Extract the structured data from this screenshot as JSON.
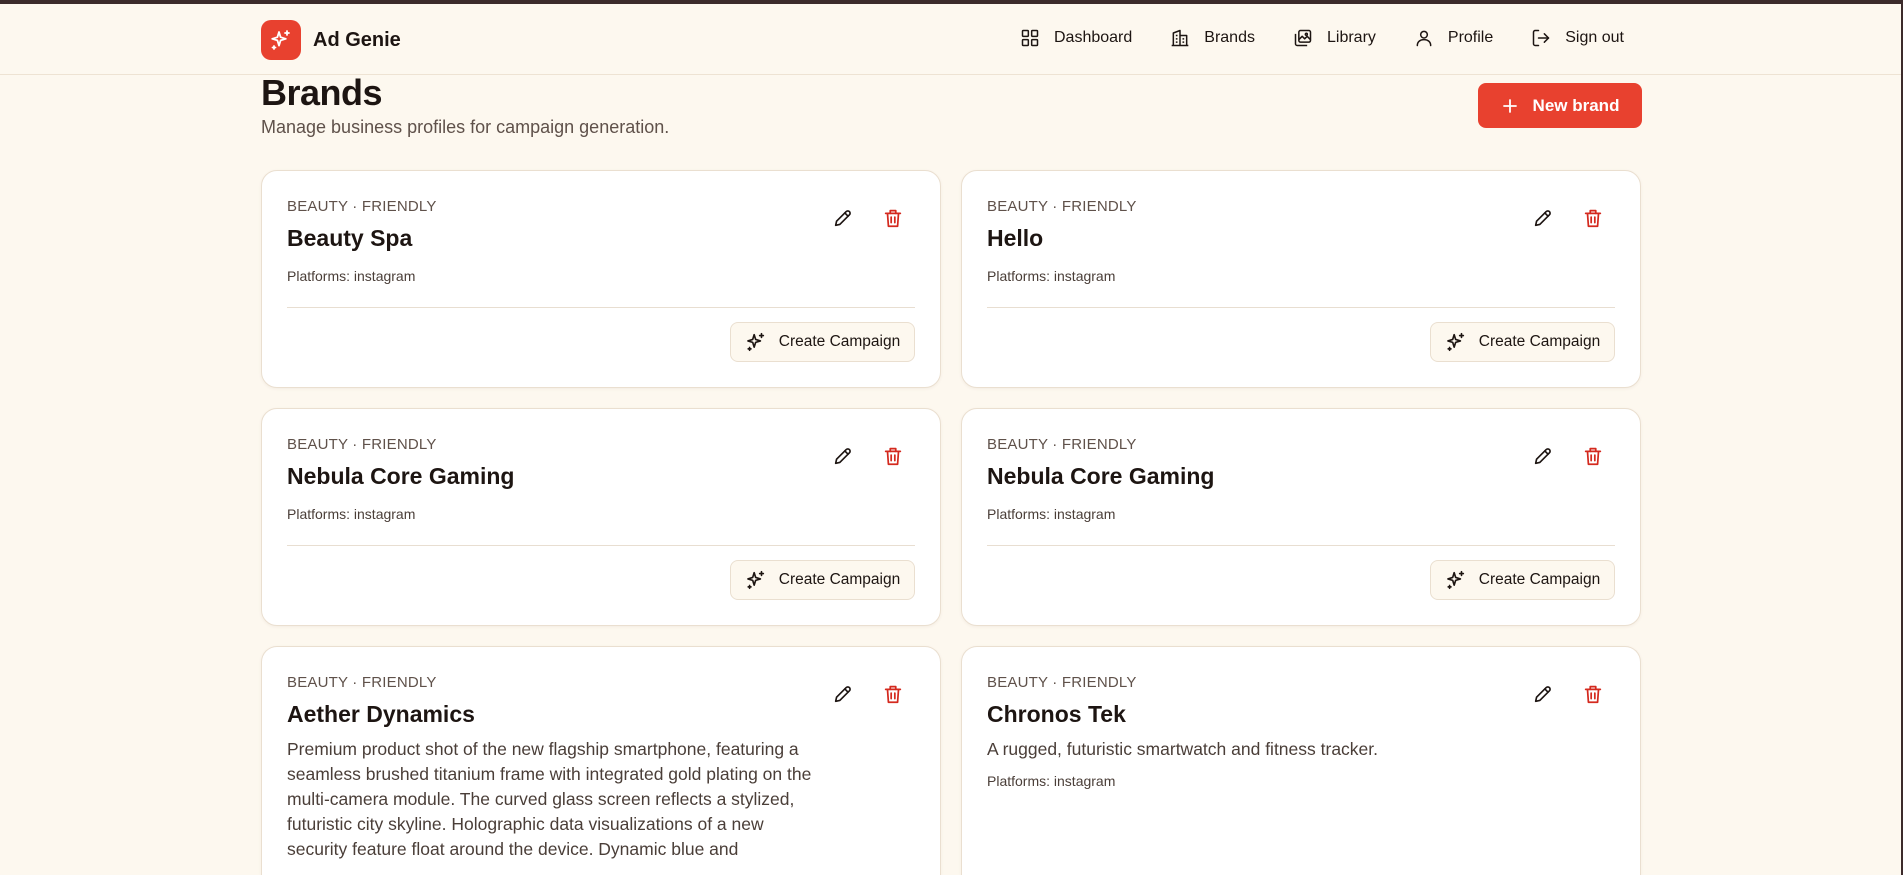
{
  "app": {
    "name": "Ad Genie"
  },
  "nav": {
    "items": [
      {
        "label": "Dashboard",
        "icon": "grid-icon"
      },
      {
        "label": "Brands",
        "icon": "building-icon"
      },
      {
        "label": "Library",
        "icon": "images-icon"
      },
      {
        "label": "Profile",
        "icon": "user-icon"
      },
      {
        "label": "Sign out",
        "icon": "logout-icon"
      }
    ]
  },
  "page": {
    "title": "Brands",
    "subtitle": "Manage business profiles for campaign generation.",
    "new_button": "New brand"
  },
  "cards": [
    {
      "category": "BEAUTY · FRIENDLY",
      "name": "Beauty Spa",
      "platforms": "Platforms: instagram",
      "action": "Create Campaign"
    },
    {
      "category": "BEAUTY · FRIENDLY",
      "name": "Hello",
      "platforms": "Platforms: instagram",
      "action": "Create Campaign"
    },
    {
      "category": "BEAUTY · FRIENDLY",
      "name": "Nebula Core Gaming",
      "platforms": "Platforms: instagram",
      "action": "Create Campaign"
    },
    {
      "category": "BEAUTY · FRIENDLY",
      "name": "Nebula Core Gaming",
      "platforms": "Platforms: instagram",
      "action": "Create Campaign"
    },
    {
      "category": "BEAUTY · FRIENDLY",
      "name": "Aether Dynamics",
      "description": "Premium product shot of the new flagship smartphone, featuring a seamless brushed titanium frame with integrated gold plating on the multi-camera module. The curved glass screen reflects a stylized, futuristic city skyline. Holographic data visualizations of a new security feature float around the device. Dynamic blue and"
    },
    {
      "category": "BEAUTY · FRIENDLY",
      "name": "Chronos Tek",
      "description": "A rugged, futuristic smartwatch and fitness tracker.",
      "platforms": "Platforms: instagram"
    }
  ],
  "colors": {
    "accent": "#e8412f",
    "background": "#fdf8ef",
    "delete": "#d42a1f"
  }
}
